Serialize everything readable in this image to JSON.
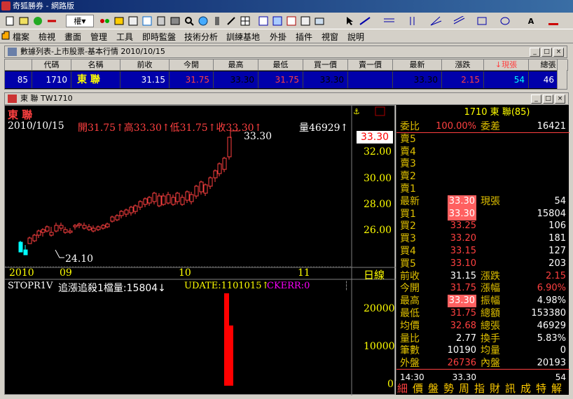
{
  "app": {
    "title": "奇狐勝券 - 網路版"
  },
  "toolbar": {
    "combo_label": "權",
    "items": [
      "new-icon",
      "notes-icon",
      "move-icon",
      "exchange-icon",
      "settings-icon",
      "traffic-icon",
      "clock-icon",
      "search-icon",
      "book-icon",
      "list-icon",
      "chart-icon",
      "grid-icon",
      "tile-icon",
      "window-icon",
      "cursor-icon",
      "line-icon",
      "text-icon",
      "shape-icon"
    ]
  },
  "menu": [
    "檔案",
    "檢視",
    "畫面",
    "管理",
    "工具",
    "即時監盤",
    "技術分析",
    "訓練基地",
    "外掛",
    "插件",
    "視窗",
    "說明"
  ],
  "quote_window": {
    "title": "數據列表-上市股票-基本行情 2010/10/15",
    "headers": [
      "",
      "代碼",
      "名稱",
      "前收",
      "今開",
      "最高",
      "最低",
      "買一價",
      "賣一價",
      "最新",
      "漲跌",
      "↓現張",
      "總張"
    ],
    "row": [
      "85",
      "1710",
      "東 聯",
      "31.15",
      "31.75",
      "33.30",
      "31.75",
      "33.30",
      "",
      "33.30",
      "2.15",
      "54",
      "46"
    ]
  },
  "chart_window": {
    "title": "東 聯 TW1710",
    "stock_name": "東 聯",
    "date": "2010/10/15",
    "ohlc_text": "開31.75↑高33.30↑低31.75↑收33.30↑",
    "volume_text": "量46929↑",
    "high_label": "33.30",
    "low_label": "24.10",
    "current_price_tag": "33.30",
    "price_axis": [
      "32.00",
      "30.00",
      "28.00",
      "26.00"
    ],
    "x_axis": [
      "2010",
      "09",
      "10",
      "11"
    ],
    "period_label": "日線",
    "indicator_label": "STOPR1V",
    "indicator_text": "追漲追殺1檔量:15804↓",
    "indicator_update": "UDATE:1101015↑",
    "indicator_ckerr": "CKERR:0",
    "volume_axis": [
      "20000",
      "10000",
      "0"
    ]
  },
  "right_panel": {
    "header": "1710 東 聯(85)",
    "rows": [
      {
        "l": "委比",
        "m": "100.00%",
        "l2": "委差",
        "r": "16421"
      },
      {
        "l": "賣5",
        "m": "",
        "l2": "",
        "r": ""
      },
      {
        "l": "賣4",
        "m": "",
        "l2": "",
        "r": ""
      },
      {
        "l": "賣3",
        "m": "",
        "l2": "",
        "r": ""
      },
      {
        "l": "賣2",
        "m": "",
        "l2": "",
        "r": ""
      },
      {
        "l": "賣1",
        "m": "",
        "l2": "",
        "r": ""
      },
      {
        "l": "最新",
        "m": "33.30",
        "l2": "現張",
        "r": "54"
      },
      {
        "l": "買1",
        "m": "33.30",
        "l2": "",
        "r": "15804"
      },
      {
        "l": "買2",
        "m": "33.25",
        "l2": "",
        "r": "106"
      },
      {
        "l": "買3",
        "m": "33.20",
        "l2": "",
        "r": "181"
      },
      {
        "l": "買4",
        "m": "33.15",
        "l2": "",
        "r": "127"
      },
      {
        "l": "買5",
        "m": "33.10",
        "l2": "",
        "r": "203"
      },
      {
        "l": "前收",
        "m": "31.15",
        "l2": "漲跌",
        "r": "2.15"
      },
      {
        "l": "今開",
        "m": "31.75",
        "l2": "漲幅",
        "r": "6.90%"
      },
      {
        "l": "最高",
        "m": "33.30",
        "l2": "振幅",
        "r": "4.98%"
      },
      {
        "l": "最低",
        "m": "31.75",
        "l2": "總額",
        "r": "153380"
      },
      {
        "l": "均價",
        "m": "32.68",
        "l2": "總張",
        "r": "46929"
      },
      {
        "l": "量比",
        "m": "2.77",
        "l2": "換手",
        "r": "5.83%"
      },
      {
        "l": "筆數",
        "m": "10190",
        "l2": "均量",
        "r": "0"
      },
      {
        "l": "外盤",
        "m": "26736",
        "l2": "內盤",
        "r": "20193"
      }
    ],
    "time": "14:30",
    "time_val": "33.30",
    "time_vol": "54",
    "tabs": [
      "細",
      "價",
      "盤",
      "勢",
      "周",
      "指",
      "財",
      "訊",
      "成",
      "特",
      "解"
    ]
  },
  "colors": {
    "up": "#ff4040",
    "down": "#00ffff",
    "label": "#e0c000"
  }
}
